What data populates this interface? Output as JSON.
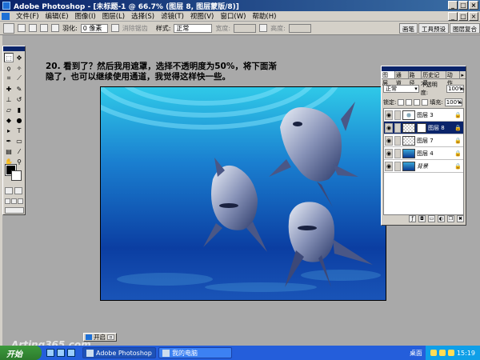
{
  "window": {
    "title": "Adobe Photoshop - [未标题-1 @ 66.7% (图层 8, 图层蒙版/8)]",
    "min": "_",
    "max": "□",
    "close": "×"
  },
  "menu": {
    "items": [
      "文件(F)",
      "编辑(E)",
      "图像(I)",
      "图层(L)",
      "选择(S)",
      "滤镜(T)",
      "视图(V)",
      "窗口(W)",
      "帮助(H)"
    ]
  },
  "options": {
    "feather_label": "羽化:",
    "feather_value": "0 像素",
    "antialias_label": "消除锯齿",
    "style_label": "样式:",
    "style_value": "正常",
    "width_label": "宽度:",
    "height_label": "高度:"
  },
  "palette_well": {
    "tabs": [
      "画笔",
      "工具预设",
      "图层复合"
    ]
  },
  "tutorial": {
    "text": "20. 看到了？然后我用遮罩，选择不透明度为50%，将下面渐隐了，也可以继续使用通道，我觉得这样快一些。"
  },
  "layers_palette": {
    "tabs": [
      "图层",
      "通道",
      "路径",
      "历史记录",
      "动作"
    ],
    "blend_mode": "正常",
    "opacity_label": "不透明度:",
    "opacity_value": "100%",
    "lock_label": "锁定:",
    "fill_label": "填充:",
    "fill_value": "100%",
    "layers": [
      {
        "name": "图层 3",
        "locked": true,
        "selected": false
      },
      {
        "name": "图层 8",
        "locked": true,
        "selected": true
      },
      {
        "name": "图层 7",
        "locked": true,
        "selected": false
      },
      {
        "name": "图层 4",
        "locked": true,
        "selected": false
      },
      {
        "name": "背景",
        "locked": true,
        "selected": false
      }
    ]
  },
  "minimized_doc": {
    "title": "开启"
  },
  "watermark": "Arting365.com",
  "taskbar": {
    "start": "开始",
    "tasks": [
      "Adobe Photoshop",
      "我的电脑"
    ],
    "desktop": "桌面",
    "clock": "15:19"
  },
  "colors": {
    "title_bar": "#0a246a",
    "taskbar": "#245edb",
    "start_button": "#3c9a3c",
    "workspace": "#a9a9a9"
  }
}
